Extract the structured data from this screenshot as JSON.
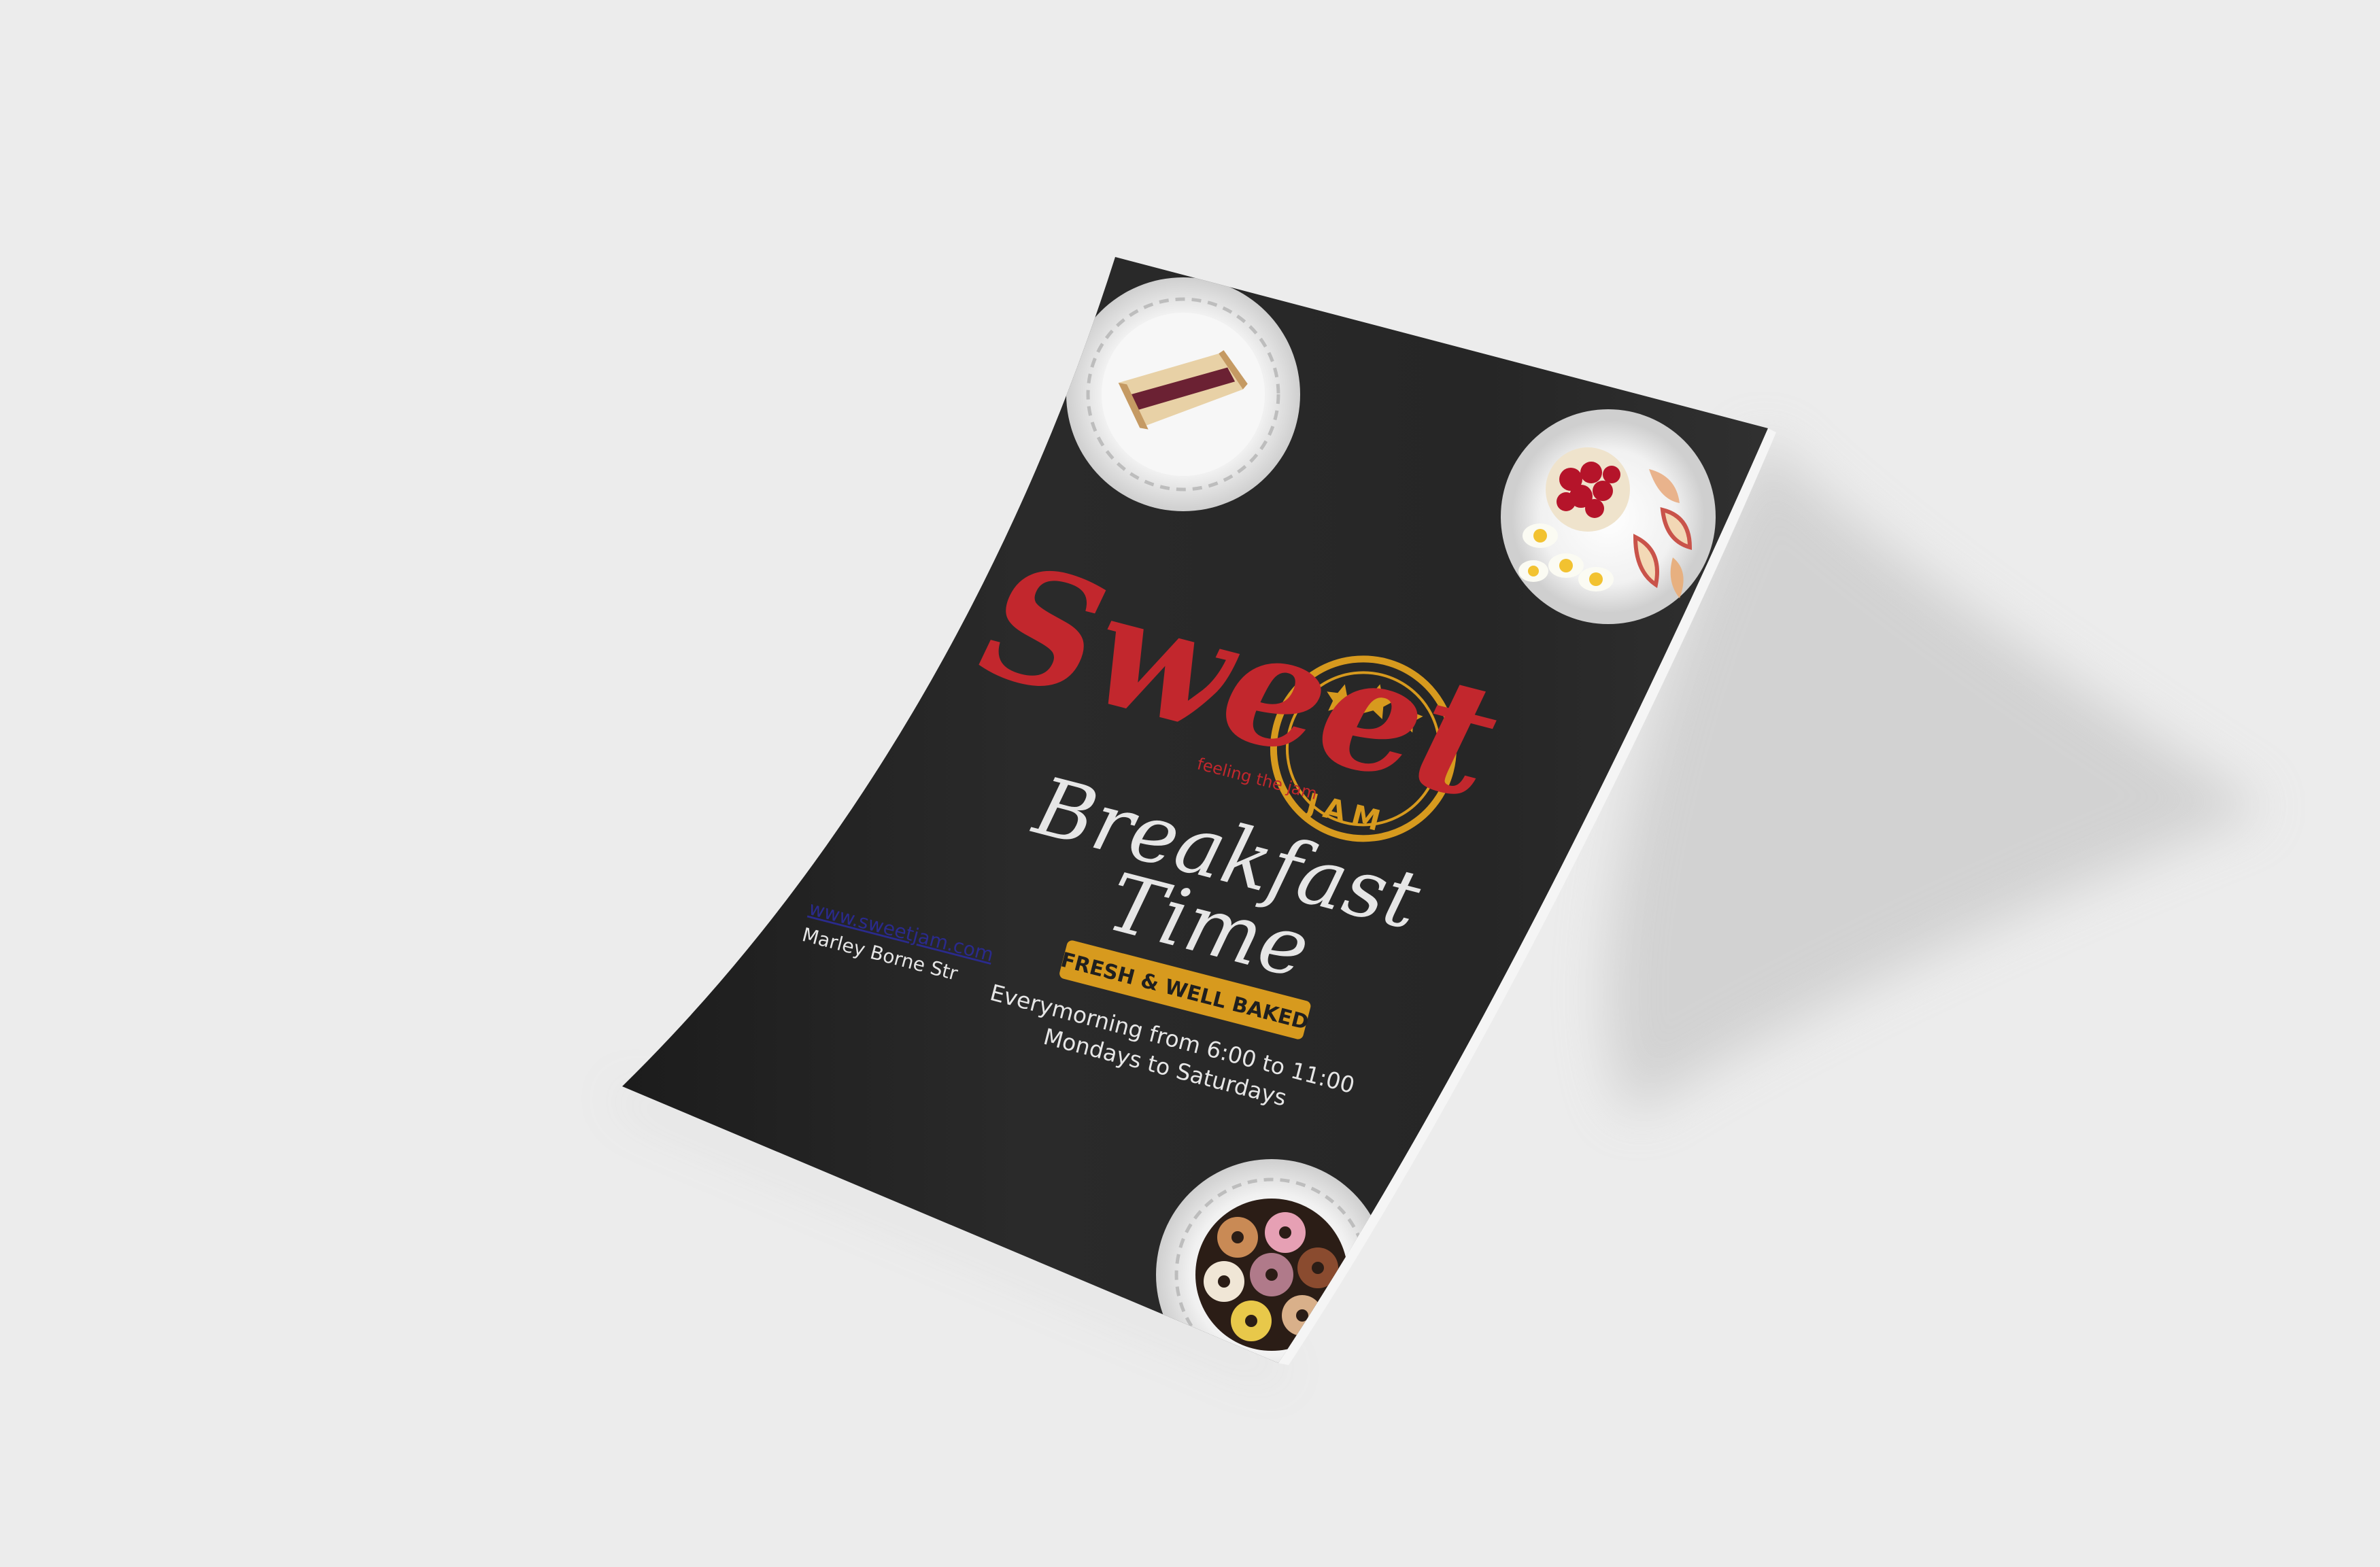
{
  "colors": {
    "background": "#ececec",
    "paper": "#262626",
    "brand_red": "#c2272d",
    "brand_gold": "#d79a1e",
    "text_light": "#e6e6e6",
    "link_blue": "#2a2a8c",
    "plate": "#d9d9d9"
  },
  "flyer": {
    "logo": {
      "word": "Sweet",
      "badge": "JAM",
      "tagline": "feeling the jam",
      "stars_icon": "three-stars-icon"
    },
    "headline_line1": "Breakfast",
    "headline_line2": "Time",
    "ribbon": "FRESH & WELL BAKED",
    "schedule_line1": "Everymorning from 6:00 to 11:00",
    "schedule_line2": "Mondays to Saturdays",
    "website": "www.sweetjam.com",
    "address": "Marley Borne Str",
    "photos": [
      {
        "icon": "sandwich-plate-icon"
      },
      {
        "icon": "fruit-and-eggs-plate-icon"
      },
      {
        "icon": "donuts-plate-icon"
      }
    ]
  }
}
